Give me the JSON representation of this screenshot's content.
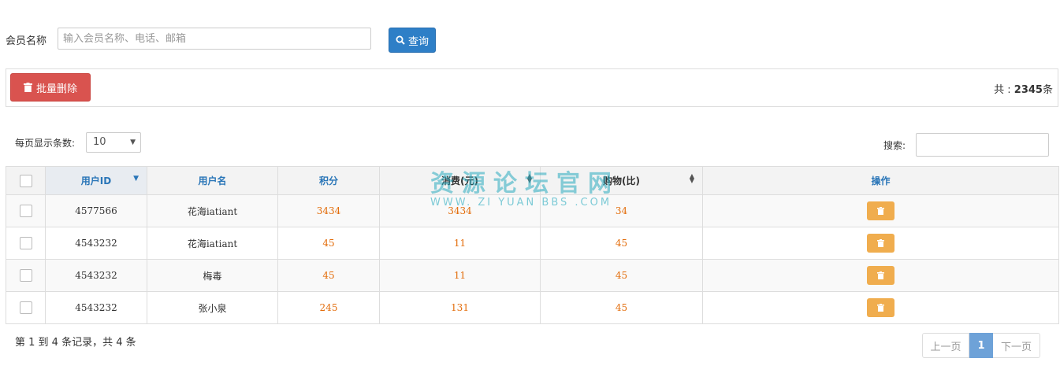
{
  "search": {
    "label": "会员名称",
    "placeholder": "输入会员名称、电话、邮箱",
    "value": "",
    "button_label": "查询"
  },
  "toolbar": {
    "batch_delete_label": "批量删除",
    "total_prefix": "共 : ",
    "total_count": "2345",
    "total_suffix": "条"
  },
  "length": {
    "label": "每页显示条数:",
    "selected": "10"
  },
  "filter": {
    "label": "搜索:",
    "value": ""
  },
  "table": {
    "columns": [
      "用户ID",
      "用户名",
      "积分",
      "消费(元)",
      "购物(比)",
      "操作"
    ],
    "rows": [
      {
        "id": "4577566",
        "name": "花海iatiant",
        "points": "3434",
        "spend": "3434",
        "shopping": "34"
      },
      {
        "id": "4543232",
        "name": "花海iatiant",
        "points": "45",
        "spend": "11",
        "shopping": "45"
      },
      {
        "id": "4543232",
        "name": "梅毒",
        "points": "45",
        "spend": "11",
        "shopping": "45"
      },
      {
        "id": "4543232",
        "name": "张小泉",
        "points": "245",
        "spend": "131",
        "shopping": "45"
      }
    ]
  },
  "info": "第 1 到 4 条记录，共 4 条",
  "pagination": {
    "prev": "上一页",
    "current": "1",
    "next": "下一页"
  },
  "watermark": {
    "title": "资源论坛官网",
    "url": "WWW. ZI YUAN BBS .COM"
  },
  "colors": {
    "primary": "#2e7fc7",
    "danger": "#d9534f",
    "warning": "#f0ad4e",
    "number": "#e36c0a"
  },
  "icons": {
    "query": "search-icon",
    "batch": "trash-icon",
    "row_delete": "trash-icon"
  }
}
